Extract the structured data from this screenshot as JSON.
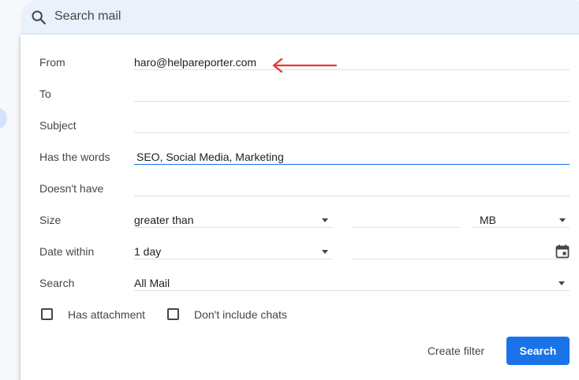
{
  "search": {
    "placeholder": "Search mail"
  },
  "form": {
    "from": {
      "label": "From",
      "value": "haro@helpareporter.com"
    },
    "to": {
      "label": "To",
      "value": ""
    },
    "subject": {
      "label": "Subject",
      "value": ""
    },
    "has_words": {
      "label": "Has the words",
      "value": "SEO, Social Media, Marketing"
    },
    "doesnt_have": {
      "label": "Doesn't have",
      "value": ""
    },
    "size": {
      "label": "Size",
      "comparator": "greater than",
      "amount": "",
      "unit": "MB"
    },
    "date_within": {
      "label": "Date within",
      "range": "1 day",
      "date": ""
    },
    "search_in": {
      "label": "Search",
      "value": "All Mail"
    },
    "has_attachment": {
      "label": "Has attachment",
      "checked": false
    },
    "dont_include_chats": {
      "label": "Don't include chats",
      "checked": false
    }
  },
  "actions": {
    "create_filter": "Create filter",
    "search": "Search"
  },
  "colors": {
    "accent": "#1a73e8",
    "annotation_arrow": "#e53935"
  },
  "icons": [
    "search-icon",
    "calendar-icon",
    "dropdown-caret-icon",
    "annotation-arrow-icon"
  ]
}
